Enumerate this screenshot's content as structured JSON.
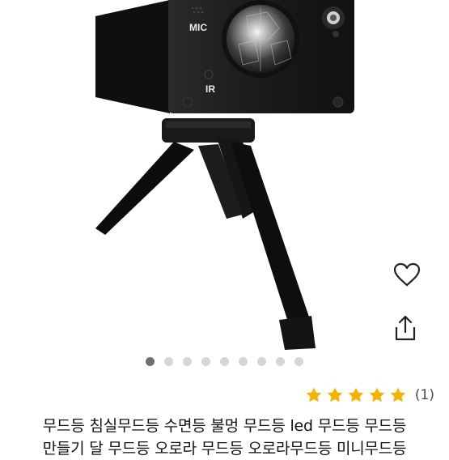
{
  "product_image": {
    "labels": {
      "mic": "MIC",
      "ir": "IR"
    }
  },
  "actions": {
    "wishlist_icon": "heart-outline-icon",
    "share_icon": "share-upload-icon"
  },
  "carousel": {
    "total": 9,
    "active_index": 0
  },
  "rating": {
    "stars": 5,
    "max": 5,
    "review_count": "(1)",
    "star_color": "#F5B301"
  },
  "title_lines": [
    "무드등 침실무드등 수면등 불멍 무드등 led 무드등 무드등",
    "만들기 달 무드등 오로라 무드등 오로라무드등 미니무드등"
  ]
}
